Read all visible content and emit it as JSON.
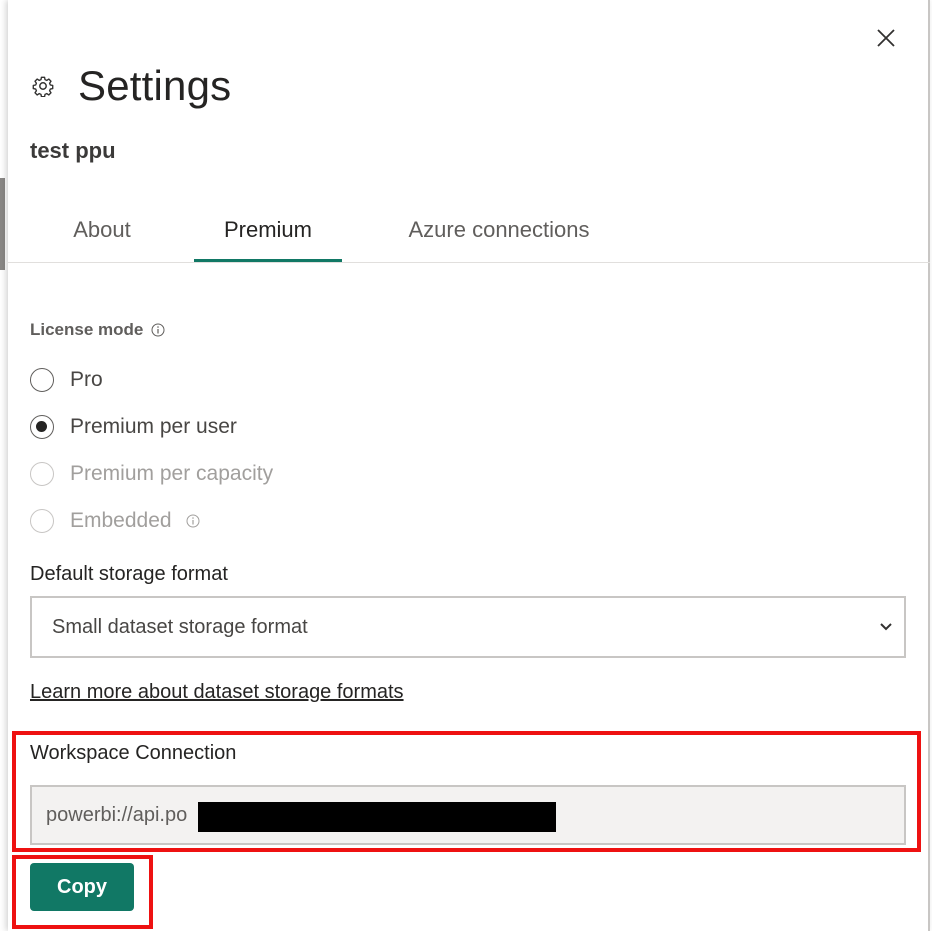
{
  "panel": {
    "title": "Settings",
    "workspace_name": "test ppu",
    "close_icon": "close-icon",
    "settings_icon": "gear-icon"
  },
  "tabs": [
    {
      "label": "About",
      "active": false
    },
    {
      "label": "Premium",
      "active": true
    },
    {
      "label": "Azure connections",
      "active": false
    }
  ],
  "license": {
    "label": "License mode",
    "options": [
      {
        "label": "Pro",
        "checked": false,
        "disabled": false
      },
      {
        "label": "Premium per user",
        "checked": true,
        "disabled": false
      },
      {
        "label": "Premium per capacity",
        "checked": false,
        "disabled": true
      },
      {
        "label": "Embedded",
        "checked": false,
        "disabled": true
      }
    ]
  },
  "storage": {
    "label": "Default storage format",
    "selected": "Small dataset storage format",
    "learn_more": "Learn more about dataset storage formats"
  },
  "connection": {
    "label": "Workspace Connection",
    "value": "powerbi://api.po",
    "copy_label": "Copy"
  },
  "colors": {
    "accent": "#117865",
    "highlight": "#ee1111"
  }
}
